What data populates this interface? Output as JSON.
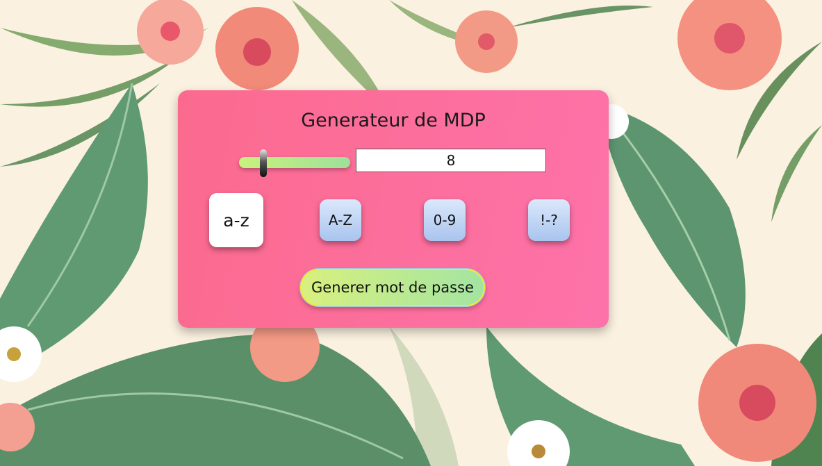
{
  "app": {
    "title": "Generateur de MDP"
  },
  "length": {
    "value": "8",
    "min": 4,
    "max": 24
  },
  "options": [
    {
      "label": "a-z",
      "active": true
    },
    {
      "label": "A-Z",
      "active": false
    },
    {
      "label": "0-9",
      "active": false
    },
    {
      "label": "!-?",
      "active": false
    }
  ],
  "actions": {
    "generate_label": "Generer mot de passe"
  },
  "colors": {
    "card": "#fd6e9c",
    "page_background": "#fbf1e0",
    "leaf": "#4f8b62",
    "flower": "#f18a78"
  }
}
